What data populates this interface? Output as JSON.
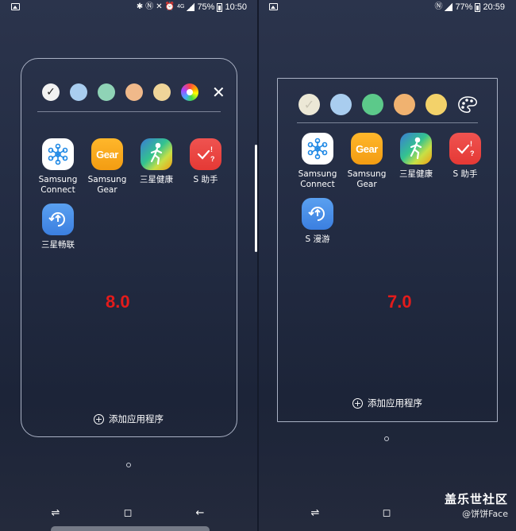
{
  "left": {
    "status": {
      "battery_pct": "75%",
      "time": "10:50",
      "network": "4G"
    },
    "colors": [
      "#f2f2f2",
      "#a9cdef",
      "#8fd3b6",
      "#f0b98a",
      "#efd599"
    ],
    "apps": [
      {
        "label": "Samsung\nConnect",
        "icon": "samsung-connect-icon"
      },
      {
        "label": "Samsung\nGear",
        "icon": "samsung-gear-icon",
        "icon_text": "Gear"
      },
      {
        "label": "三星健康",
        "icon": "samsung-health-icon"
      },
      {
        "label": "S 助手",
        "icon": "bixby-reminder-icon"
      },
      {
        "label": "三星畅联",
        "icon": "samsung-flow-icon"
      }
    ],
    "version": "8.0",
    "add_apps": "添加应用程序"
  },
  "right": {
    "status": {
      "battery_pct": "77%",
      "time": "20:59"
    },
    "colors": [
      "#ece8d6",
      "#a9cdef",
      "#5cc98a",
      "#f0b270",
      "#f3d26a"
    ],
    "apps": [
      {
        "label": "Samsung\nConnect",
        "icon": "samsung-connect-icon"
      },
      {
        "label": "Samsung\nGear",
        "icon": "samsung-gear-icon",
        "icon_text": "Gear"
      },
      {
        "label": "三星健康",
        "icon": "samsung-health-icon"
      },
      {
        "label": "S 助手",
        "icon": "bixby-reminder-icon"
      },
      {
        "label": "S 漫游",
        "icon": "s-roaming-icon"
      }
    ],
    "version": "7.0",
    "add_apps": "添加应用程序"
  },
  "watermark": {
    "line1": "盖乐世社区",
    "line2": "@饼饼Face"
  }
}
